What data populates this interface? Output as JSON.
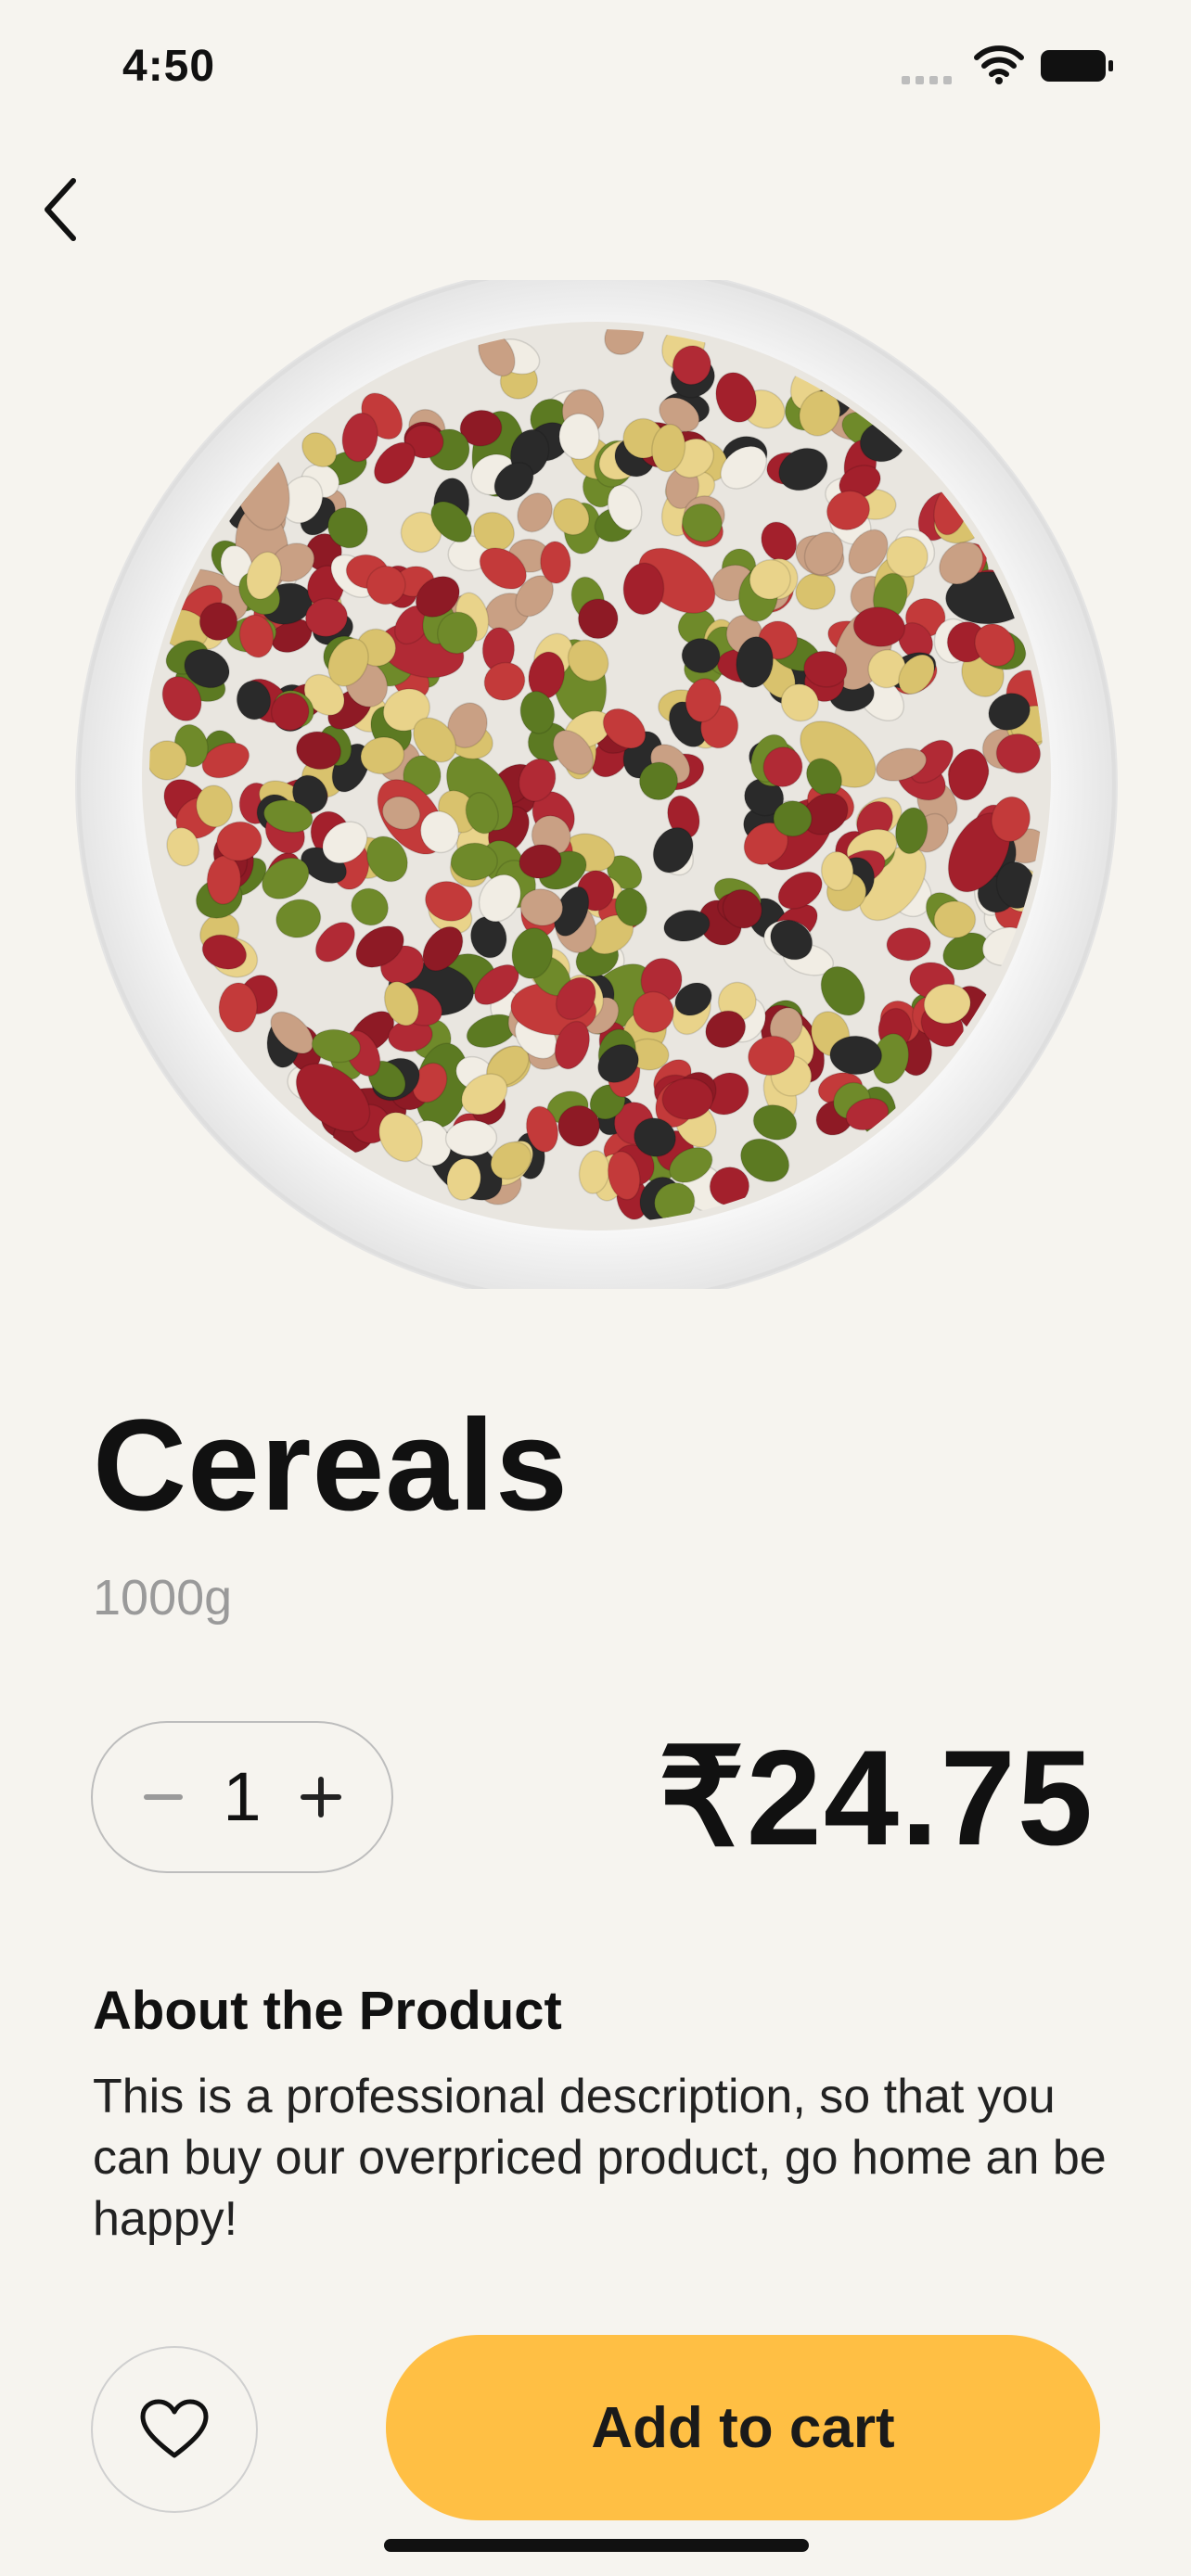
{
  "status_bar": {
    "time": "4:50"
  },
  "product": {
    "title": "Cereals",
    "weight": "1000g",
    "quantity": "1",
    "price": "₹24.75"
  },
  "about": {
    "heading": "About the Product",
    "text": "This is a professional description, so that you can buy our overpriced product, go home an be happy!"
  },
  "actions": {
    "add_to_cart_label": "Add to cart"
  },
  "icons": {
    "back": "chevron-left-icon",
    "favorite": "heart-icon",
    "decrease": "minus-icon",
    "increase": "plus-icon",
    "wifi": "wifi-icon",
    "battery": "battery-icon"
  },
  "colors": {
    "background": "#f6f4ef",
    "accent": "#ffbf44"
  }
}
